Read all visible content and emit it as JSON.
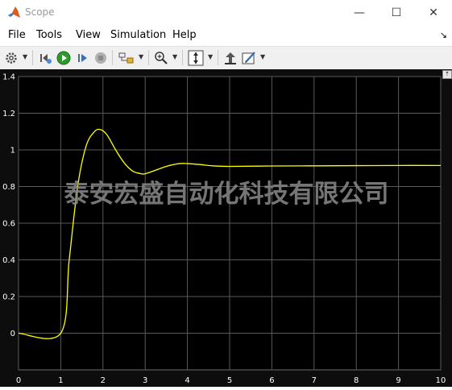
{
  "window": {
    "title": "Scope",
    "minimize_glyph": "—",
    "maximize_glyph": "☐",
    "close_glyph": "✕"
  },
  "menu": {
    "items": [
      "File",
      "Tools",
      "View",
      "Simulation",
      "Help"
    ],
    "overflow_arrow": "↘"
  },
  "toolbar": {
    "icons": [
      "settings-icon",
      "step-back-icon",
      "run-icon",
      "step-forward-icon",
      "stop-icon",
      "signal-select-icon",
      "zoom-icon",
      "autoscale-icon",
      "restore-view-icon",
      "style-icon"
    ]
  },
  "watermark": "泰安宏盛自动化科技有限公司",
  "colors": {
    "plot_background": "#000000",
    "trace": "#ffff00",
    "grid": "#5a5a5a",
    "tick_label": "#ffffff",
    "accent_run": "#2e9a2e"
  },
  "chart_data": {
    "type": "line",
    "title": "",
    "xlabel": "",
    "ylabel": "",
    "xlim": [
      0,
      10
    ],
    "ylim": [
      -0.2,
      1.4
    ],
    "grid": true,
    "xticks": [
      "0",
      "1",
      "2",
      "3",
      "4",
      "5",
      "6",
      "7",
      "8",
      "9",
      "10"
    ],
    "yticks": [
      "0",
      "0.2",
      "0.4",
      "0.6",
      "0.8",
      "1",
      "1.2",
      "1.4"
    ],
    "series": [
      {
        "color": "#ffff00",
        "x": [
          0,
          1.0,
          1.2,
          1.4,
          1.6,
          1.8,
          1.95,
          2.1,
          2.3,
          2.5,
          2.7,
          2.9,
          3.0,
          3.2,
          3.5,
          3.8,
          4.0,
          4.3,
          4.6,
          5.0,
          6.0,
          7.0,
          8.0,
          9.0,
          10.0
        ],
        "y": [
          0,
          0,
          0.4,
          0.8,
          1.02,
          1.1,
          1.11,
          1.08,
          1.0,
          0.93,
          0.885,
          0.87,
          0.87,
          0.885,
          0.91,
          0.925,
          0.925,
          0.92,
          0.913,
          0.91,
          0.912,
          0.913,
          0.914,
          0.915,
          0.915
        ]
      }
    ]
  }
}
